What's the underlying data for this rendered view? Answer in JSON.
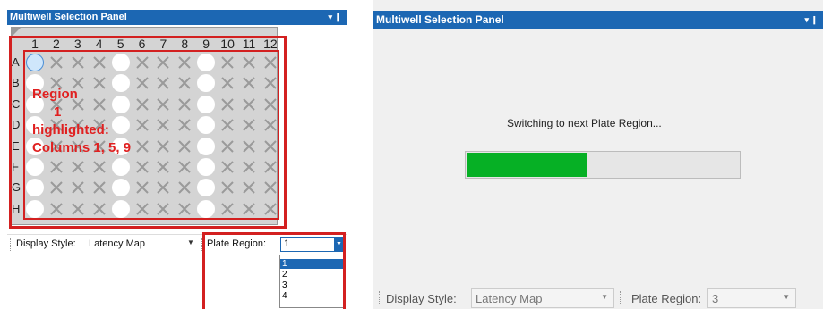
{
  "left": {
    "title": "Multiwell Selection Panel",
    "title_icons": "▾ ❙",
    "columns": [
      "1",
      "2",
      "3",
      "4",
      "5",
      "6",
      "7",
      "8",
      "9",
      "10",
      "11",
      "12"
    ],
    "rows": [
      "A",
      "B",
      "C",
      "D",
      "E",
      "F",
      "G",
      "H"
    ],
    "annotation": [
      "Region",
      "1",
      "highlighted:",
      "Columns 1, 5, 9"
    ],
    "display_style_label": "Display Style:",
    "display_style_value": "Latency Map",
    "plate_region_label": "Plate Region:",
    "plate_region_value": "1",
    "plate_region_options": [
      "1",
      "2",
      "3",
      "4"
    ],
    "plate_region_highlighted": "1"
  },
  "right": {
    "title": "Multiwell Selection Panel",
    "title_icons": "▾ ❙",
    "status": "Switching to next Plate Region...",
    "progress": 0.44,
    "display_style_label": "Display Style:",
    "display_style_value": "Latency Map",
    "plate_region_label": "Plate Region:",
    "plate_region_value": "3"
  },
  "colors": {
    "titlebar": "#1c67b3",
    "highlight_red": "#d32020",
    "progress_green": "#06b025"
  },
  "icons": [
    "dropdown-caret-icon",
    "pin-icon",
    "x-mark-icon",
    "toolbar-grip-icon"
  ]
}
